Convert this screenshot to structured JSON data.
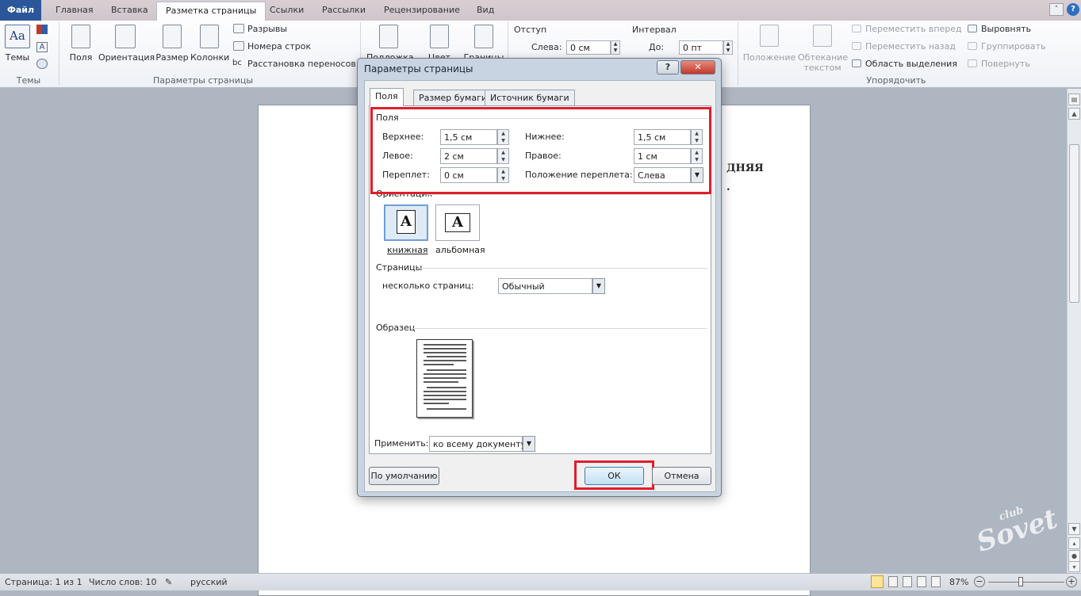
{
  "tabs": {
    "file": "Файл",
    "home": "Главная",
    "insert": "Вставка",
    "layout": "Разметка страницы",
    "references": "Ссылки",
    "mailings": "Рассылки",
    "review": "Рецензирование",
    "view": "Вид"
  },
  "ribbon": {
    "themes": {
      "button": "Темы",
      "group": "Темы"
    },
    "page_setup": {
      "group": "Параметры страницы",
      "margins": "Поля",
      "orientation": "Ориентация",
      "size": "Размер",
      "columns": "Колонки",
      "breaks": "Разрывы",
      "line_numbers": "Номера строк",
      "hyphenation": "Расстановка переносов"
    },
    "background": {
      "watermark": "Подложка",
      "color": "Цвет",
      "borders": "Границы"
    },
    "paragraph": {
      "indent_title": "Отступ",
      "indent_left_label": "Слева:",
      "indent_left_value": "0 см",
      "spacing_title": "Интервал",
      "spacing_before_label": "До:",
      "spacing_before_value": "0 пт"
    },
    "arrange": {
      "group": "Упорядочить",
      "position": "Положение",
      "wrap_1": "Обтекание",
      "wrap_2": "текстом",
      "bring_forward": "Переместить вперед",
      "send_backward": "Переместить назад",
      "selection_pane": "Область выделения",
      "align": "Выровнять",
      "group_btn": "Группировать",
      "rotate": "Повернуть"
    }
  },
  "document": {
    "line1": "ДНЯЯ",
    "line2": "."
  },
  "dialog": {
    "title": "Параметры страницы",
    "help": "?",
    "close": "✕",
    "tabs": [
      "Поля",
      "Размер бумаги",
      "Источник бумаги"
    ],
    "margins_section": "Поля",
    "top_label": "Верхнее:",
    "top_value": "1,5 см",
    "bottom_label": "Нижнее:",
    "bottom_value": "1,5 см",
    "left_label": "Левое:",
    "left_value": "2 см",
    "right_label": "Правое:",
    "right_value": "1 см",
    "gutter_label": "Переплет:",
    "gutter_value": "0 см",
    "gutter_pos_label": "Положение переплета:",
    "gutter_pos_value": "Слева",
    "orientation_section": "Ориентация",
    "portrait": "книжная",
    "landscape": "альбомная",
    "pages_section": "Страницы",
    "multiple_pages_label": "несколько страниц:",
    "multiple_pages_value": "Обычный",
    "preview_section": "Образец",
    "apply_label": "Применить:",
    "apply_value": "ко всему документу",
    "default_button": "По умолчанию",
    "ok_button": "ОК",
    "cancel_button": "Отмена"
  },
  "status": {
    "page": "Страница: 1 из 1",
    "words": "Число слов: 10",
    "language": "русский",
    "zoom": "87%"
  },
  "watermark": "Sovet",
  "watermark_small": "club",
  "colors": {
    "file_tab": "#2b579a",
    "highlight": "#e01e2c",
    "dialog_frame": "#c9d4e2"
  }
}
